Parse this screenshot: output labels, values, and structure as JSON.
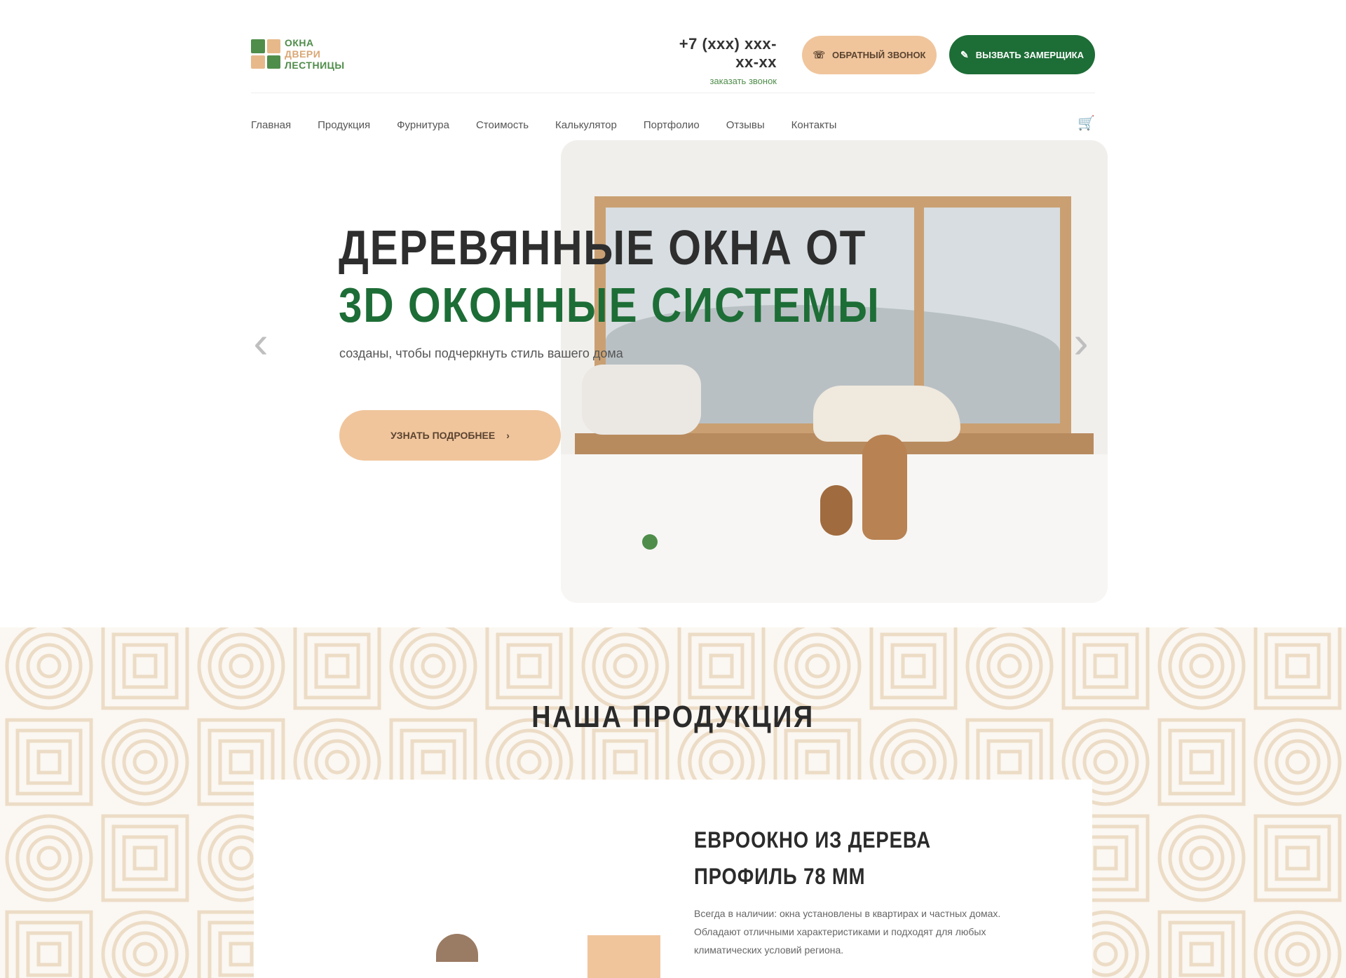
{
  "header": {
    "logo": {
      "line1": "ОКНА",
      "line2": "ДВЕРИ",
      "line3": "ЛЕСТНИЦЫ"
    },
    "phone": "+7 (xxx) xxx-xx-xx",
    "phone_sub": "заказать звонок",
    "callback_label": "Обратный звонок",
    "measure_label": "Вызвать замерщика"
  },
  "nav": {
    "items": [
      "Главная",
      "Продукция",
      "Фурнитура",
      "Стоимость",
      "Калькулятор",
      "Портфолио",
      "Отзывы",
      "Контакты"
    ],
    "cart_icon": "cart-icon"
  },
  "hero": {
    "title_line1": "ДЕРЕВЯННЫЕ ОКНА ОТ",
    "title_line2": "3D ОКОННЫЕ СИСТЕМЫ",
    "subtitle": "созданы, чтобы подчеркнуть стиль вашего дома",
    "more_label": "Узнать подробнее",
    "more_icon": "arrow-right-icon",
    "prev_icon": "‹",
    "next_icon": "›"
  },
  "products": {
    "section_title": "НАША ПРОДУКЦИЯ",
    "card": {
      "title": "ЕВРООКНО ИЗ ДЕРЕВА ПРОФИЛЬ 78 ММ",
      "description": "Всегда в наличии: окна установлены в квартирах и частных домах. Обладают отличными характеристиками и подходят для любых климатических условий региона."
    }
  },
  "colors": {
    "green": "#1d6d36",
    "peach": "#f0c59c",
    "text": "#2e2e2e"
  }
}
